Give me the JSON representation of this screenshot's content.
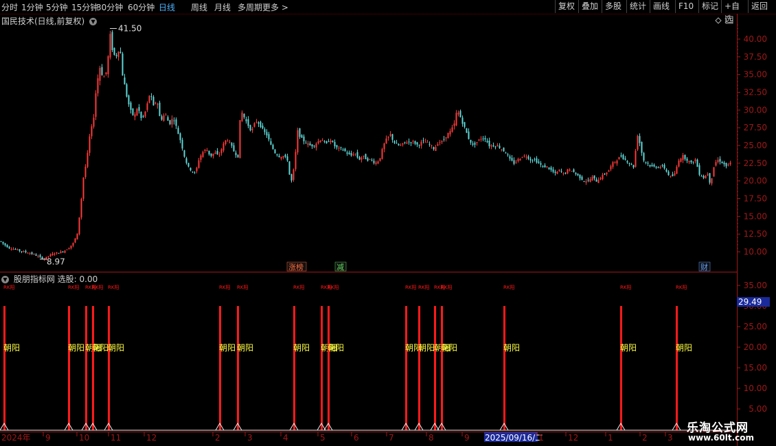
{
  "toolbar": {
    "periods": [
      "分时",
      "1分钟",
      "5分钟",
      "15分钟",
      "30分钟",
      "60分钟",
      "日线",
      "周线",
      "月线",
      "多周期",
      "更多 >"
    ],
    "active": "日线",
    "right_buttons": [
      "复权",
      "叠加",
      "多股",
      "统计",
      "画线",
      "F10",
      "标记",
      "+自选",
      "返回"
    ]
  },
  "main": {
    "title": "国民技术(日线,前复权)",
    "high_label": "41.50",
    "low_label": "8.97",
    "events": [
      "涨榜",
      "减",
      "财"
    ]
  },
  "indicator": {
    "title": "股朋指标网",
    "value_label": "选股: 0.00",
    "current_value": "29.49",
    "signal_label": "朝阳",
    "signal_small": "RK阳"
  },
  "watermark": {
    "name": "乐淘公式网",
    "url": "www.60lt.com"
  },
  "colors": {
    "up": "#ff3a3a",
    "down": "#5fd8d8",
    "axis": "#a01818",
    "signal": "#ff1a1a",
    "label": "#ffff40"
  },
  "chart_data": [
    {
      "type": "candlestick",
      "title": "国民技术(日线,前复权)",
      "y_ticks": [
        10.0,
        12.5,
        15.0,
        17.5,
        20.0,
        22.5,
        25.0,
        27.5,
        30.0,
        32.5,
        35.0,
        37.5,
        40.0
      ],
      "ylim": [
        8.0,
        42.0
      ],
      "annotations": [
        {
          "label": "41.50",
          "value": 41.5
        },
        {
          "label": "8.97",
          "value": 8.97
        }
      ],
      "path": [
        [
          0,
          11.5
        ],
        [
          6,
          11.0
        ],
        [
          12,
          10.6
        ],
        [
          20,
          10.4
        ],
        [
          30,
          10.1
        ],
        [
          40,
          9.9
        ],
        [
          50,
          9.6
        ],
        [
          58,
          9.2
        ],
        [
          64,
          9.0
        ],
        [
          70,
          9.4
        ],
        [
          78,
          9.8
        ],
        [
          86,
          9.9
        ],
        [
          94,
          10.2
        ],
        [
          100,
          10.6
        ],
        [
          106,
          11.2
        ],
        [
          112,
          12.5
        ],
        [
          117,
          16.5
        ],
        [
          121,
          20.5
        ],
        [
          126,
          23.0
        ],
        [
          131,
          27.0
        ],
        [
          135,
          28.0
        ],
        [
          140,
          33.5
        ],
        [
          145,
          36.0
        ],
        [
          150,
          34.5
        ],
        [
          155,
          35.5
        ],
        [
          160,
          40.5
        ],
        [
          164,
          38.0
        ],
        [
          168,
          37.5
        ],
        [
          174,
          39.0
        ],
        [
          178,
          35.0
        ],
        [
          184,
          32.0
        ],
        [
          189,
          30.0
        ],
        [
          195,
          29.0
        ],
        [
          200,
          30.5
        ],
        [
          206,
          28.5
        ],
        [
          212,
          30.0
        ],
        [
          218,
          32.5
        ],
        [
          223,
          30.5
        ],
        [
          228,
          31.5
        ],
        [
          233,
          28.5
        ],
        [
          240,
          29.5
        ],
        [
          246,
          28.0
        ],
        [
          252,
          29.0
        ],
        [
          258,
          27.0
        ],
        [
          263,
          25.5
        ],
        [
          268,
          23.5
        ],
        [
          273,
          22.0
        ],
        [
          278,
          21.5
        ],
        [
          284,
          21.0
        ],
        [
          289,
          23.0
        ],
        [
          294,
          24.0
        ],
        [
          300,
          24.5
        ],
        [
          306,
          23.5
        ],
        [
          312,
          24.0
        ],
        [
          318,
          23.5
        ],
        [
          324,
          25.0
        ],
        [
          330,
          26.0
        ],
        [
          336,
          25.0
        ],
        [
          341,
          24.0
        ],
        [
          346,
          23.5
        ],
        [
          350,
          30.0
        ],
        [
          355,
          29.0
        ],
        [
          360,
          28.0
        ],
        [
          366,
          27.0
        ],
        [
          372,
          28.5
        ],
        [
          378,
          28.0
        ],
        [
          383,
          27.0
        ],
        [
          388,
          26.5
        ],
        [
          394,
          25.0
        ],
        [
          400,
          24.0
        ],
        [
          406,
          23.5
        ],
        [
          412,
          23.5
        ],
        [
          418,
          23.0
        ],
        [
          423,
          19.5
        ],
        [
          428,
          22.0
        ],
        [
          433,
          27.0
        ],
        [
          438,
          26.0
        ],
        [
          444,
          25.5
        ],
        [
          450,
          25.0
        ],
        [
          456,
          25.0
        ],
        [
          462,
          25.5
        ],
        [
          468,
          26.0
        ],
        [
          474,
          25.0
        ],
        [
          480,
          26.0
        ],
        [
          486,
          25.0
        ],
        [
          492,
          24.5
        ],
        [
          498,
          24.5
        ],
        [
          504,
          24.0
        ],
        [
          510,
          23.5
        ],
        [
          516,
          24.0
        ],
        [
          522,
          23.0
        ],
        [
          528,
          23.5
        ],
        [
          534,
          23.0
        ],
        [
          540,
          23.0
        ],
        [
          546,
          22.5
        ],
        [
          552,
          23.0
        ],
        [
          558,
          25.0
        ],
        [
          563,
          26.0
        ],
        [
          568,
          26.5
        ],
        [
          573,
          25.5
        ],
        [
          578,
          25.0
        ],
        [
          584,
          25.0
        ],
        [
          590,
          25.5
        ],
        [
          596,
          25.5
        ],
        [
          602,
          25.5
        ],
        [
          608,
          25.0
        ],
        [
          614,
          25.5
        ],
        [
          620,
          25.5
        ],
        [
          626,
          25.0
        ],
        [
          632,
          24.5
        ],
        [
          638,
          25.5
        ],
        [
          644,
          25.5
        ],
        [
          650,
          26.5
        ],
        [
          656,
          27.0
        ],
        [
          661,
          28.0
        ],
        [
          665,
          30.0
        ],
        [
          670,
          29.0
        ],
        [
          676,
          27.5
        ],
        [
          682,
          26.0
        ],
        [
          688,
          25.0
        ],
        [
          694,
          25.5
        ],
        [
          700,
          26.0
        ],
        [
          706,
          26.0
        ],
        [
          712,
          25.0
        ],
        [
          718,
          25.0
        ],
        [
          724,
          25.0
        ],
        [
          730,
          24.5
        ],
        [
          736,
          24.0
        ],
        [
          742,
          23.0
        ],
        [
          748,
          22.5
        ],
        [
          754,
          23.0
        ],
        [
          760,
          23.5
        ],
        [
          766,
          23.5
        ],
        [
          772,
          23.0
        ],
        [
          778,
          23.0
        ],
        [
          784,
          22.5
        ],
        [
          790,
          22.0
        ],
        [
          796,
          22.0
        ],
        [
          802,
          21.5
        ],
        [
          808,
          21.0
        ],
        [
          814,
          21.5
        ],
        [
          820,
          21.0
        ],
        [
          826,
          21.5
        ],
        [
          832,
          21.5
        ],
        [
          838,
          21.0
        ],
        [
          844,
          20.5
        ],
        [
          850,
          20.0
        ],
        [
          856,
          20.0
        ],
        [
          862,
          20.5
        ],
        [
          868,
          20.0
        ],
        [
          874,
          20.5
        ],
        [
          880,
          21.0
        ],
        [
          886,
          21.5
        ],
        [
          892,
          22.5
        ],
        [
          898,
          23.0
        ],
        [
          904,
          23.5
        ],
        [
          910,
          23.0
        ],
        [
          916,
          22.5
        ],
        [
          922,
          22.0
        ],
        [
          928,
          26.5
        ],
        [
          932,
          25.0
        ],
        [
          936,
          23.0
        ],
        [
          942,
          22.5
        ],
        [
          948,
          22.0
        ],
        [
          954,
          22.0
        ],
        [
          960,
          22.0
        ],
        [
          966,
          22.0
        ],
        [
          972,
          21.0
        ],
        [
          977,
          20.5
        ],
        [
          982,
          21.0
        ],
        [
          988,
          23.0
        ],
        [
          994,
          23.5
        ],
        [
          1000,
          23.0
        ],
        [
          1006,
          22.5
        ],
        [
          1012,
          23.0
        ],
        [
          1018,
          21.0
        ],
        [
          1024,
          20.5
        ],
        [
          1030,
          21.0
        ],
        [
          1034,
          19.5
        ],
        [
          1040,
          22.5
        ],
        [
          1046,
          23.0
        ],
        [
          1052,
          22.5
        ],
        [
          1058,
          22.0
        ],
        [
          1063,
          22.5
        ]
      ]
    },
    {
      "type": "bar",
      "title": "股朋指标网",
      "y_ticks": [
        5.0,
        10.0,
        15.0,
        20.0,
        25.0,
        30.0,
        35.0
      ],
      "ylim": [
        0,
        38
      ],
      "signal_x": [
        6,
        100,
        125,
        135,
        158,
        320,
        346,
        428,
        468,
        478,
        591,
        610,
        633,
        643,
        734,
        904,
        985
      ],
      "signal_value": 30,
      "x_tick_labels": [
        "2024年",
        "9",
        "10",
        "11",
        "12",
        "2",
        "3",
        "4",
        "5",
        "6",
        "7",
        "8",
        "9",
        "2025/09/16/二",
        "1",
        "12",
        "1",
        "2",
        "3"
      ]
    }
  ]
}
